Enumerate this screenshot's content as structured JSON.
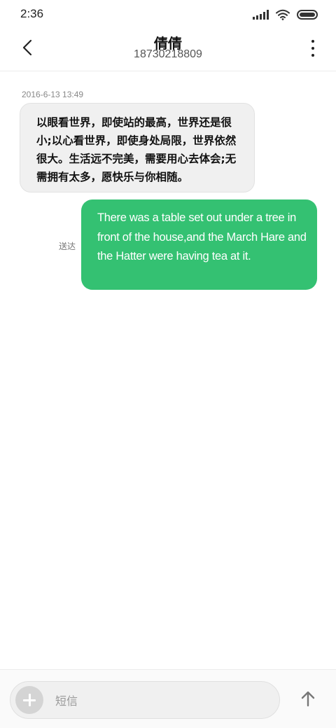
{
  "status_bar": {
    "time": "2:36"
  },
  "header": {
    "contact_name": "倩倩",
    "phone_number": "18730218809"
  },
  "conversation": {
    "timestamp": "2016-6-13 13:49",
    "messages": [
      {
        "direction": "incoming",
        "text": "以眼看世界，即使站的最高，世界还是很小;以心看世界，即使身处局限，世界依然很大。生活远不完美，需要用心去体会;无需拥有太多，愿快乐与你相随。"
      },
      {
        "direction": "outgoing",
        "status": "送达",
        "text": "There was a table set out under a tree in front of the house,and the March Hare and the Hatter were having tea at it."
      }
    ]
  },
  "composer": {
    "placeholder": "短信"
  },
  "colors": {
    "outgoing_bubble": "#34c172",
    "incoming_bubble": "#f0f0f0"
  }
}
